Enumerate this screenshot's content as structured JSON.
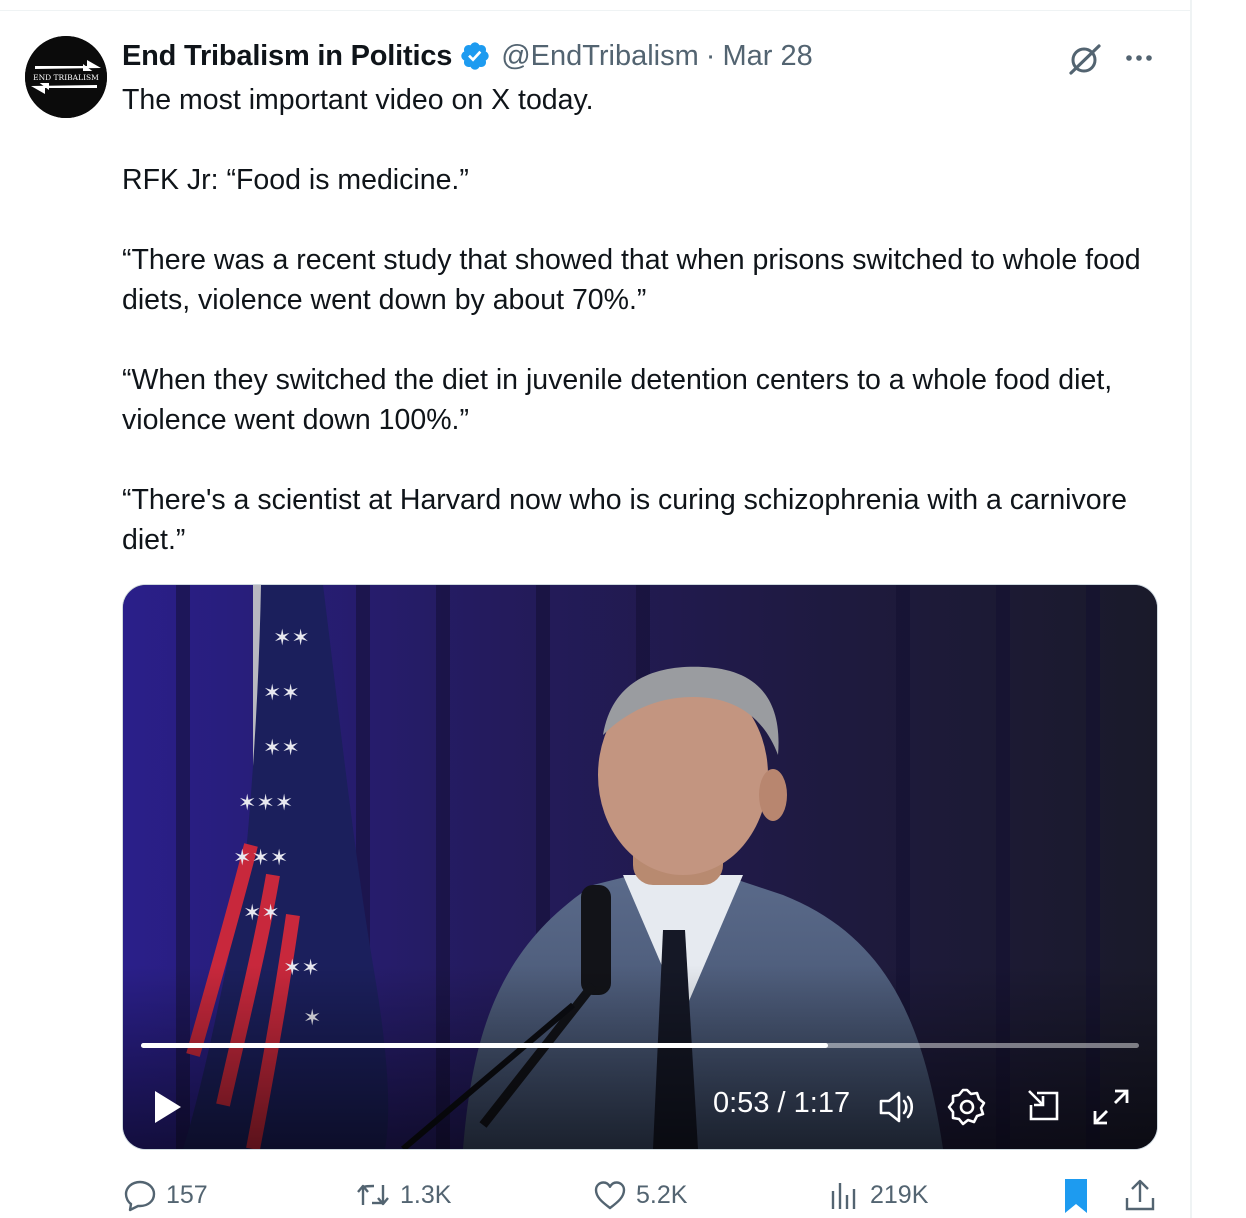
{
  "author": {
    "display_name": "End Tribalism in Politics",
    "handle": "@EndTribalism",
    "date": "Mar 28",
    "avatar_text": "END TRIBALISM",
    "verified": true
  },
  "tweet": {
    "paragraphs": [
      "The most important video on X today.",
      "RFK Jr: “Food is medicine.”",
      "“There was a recent study that showed that when prisons switched to whole food diets, violence went down by about 70%.”",
      "“When they switched the diet in juvenile detention centers to a whole food diet, violence went down 100%.”",
      "“There's a scientist at Harvard now who is curing schizophrenia with a carnivore diet.”"
    ]
  },
  "video": {
    "current_time": "0:53",
    "duration": "1:17",
    "progress_fraction": 0.688
  },
  "actions": {
    "replies": "157",
    "reposts": "1.3K",
    "likes": "5.2K",
    "views": "219K"
  },
  "icons": {
    "verified": "verified-badge-icon",
    "grok": "grok-icon",
    "more": "more-icon",
    "play": "play-icon",
    "volume": "volume-icon",
    "settings": "settings-icon",
    "pip": "picture-in-picture-icon",
    "fullscreen": "fullscreen-icon",
    "reply": "reply-icon",
    "repost": "repost-icon",
    "like": "like-icon",
    "views": "views-icon",
    "bookmark": "bookmark-icon",
    "share": "share-icon"
  },
  "colors": {
    "verified": "#1d9bf0",
    "bookmark": "#1d9bf0",
    "secondary_text": "#536471"
  }
}
